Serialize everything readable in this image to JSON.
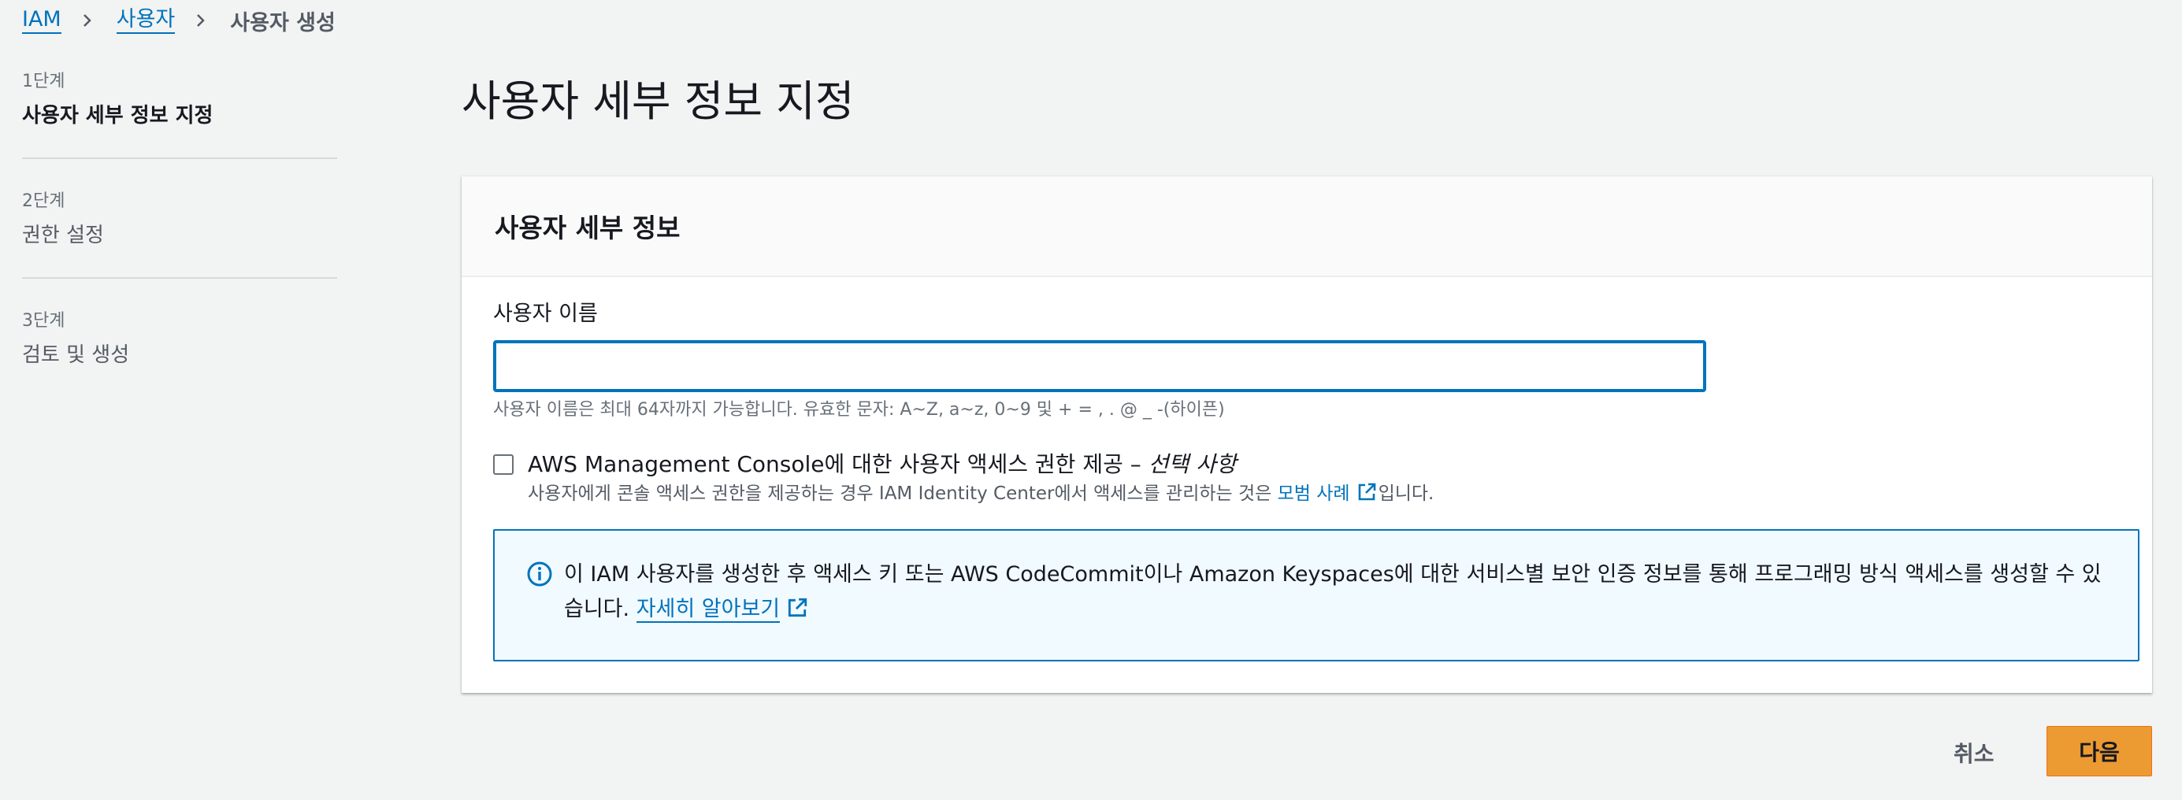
{
  "breadcrumb": {
    "items": [
      "IAM",
      "사용자"
    ],
    "current": "사용자 생성"
  },
  "steps": [
    {
      "number": "1단계",
      "label": "사용자 세부 정보 지정",
      "active": true
    },
    {
      "number": "2단계",
      "label": "권한 설정",
      "active": false
    },
    {
      "number": "3단계",
      "label": "검토 및 생성",
      "active": false
    }
  ],
  "page": {
    "title": "사용자 세부 정보 지정"
  },
  "panel": {
    "header": "사용자 세부 정보",
    "username_label": "사용자 이름",
    "username_value": "",
    "username_constraint": "사용자 이름은 최대 64자까지 가능합니다. 유효한 문자: A~Z, a~z, 0~9 및 + = , . @ _ -(하이픈)",
    "console_access": {
      "checked": false,
      "title": "AWS Management Console에 대한 사용자 액세스 권한 제공",
      "title_dash": " – ",
      "optional": "선택 사항",
      "desc_prefix": "사용자에게 콘솔 액세스 권한을 제공하는 경우 IAM Identity Center에서 액세스를 관리하는 것은 ",
      "desc_link": "모범 사례",
      "desc_suffix": "입니다."
    },
    "info": {
      "text": "이 IAM 사용자를 생성한 후 액세스 키 또는 AWS CodeCommit이나 Amazon Keyspaces에 대한 서비스별 보안 인증 정보를 통해 프로그래밍 방식 액세스를 생성할 수 있습니다. ",
      "link": "자세히 알아보기"
    }
  },
  "footer": {
    "cancel_label": "취소",
    "next_label": "다음"
  },
  "colors": {
    "link": "#0073bb",
    "primary_button": "#ec9a32",
    "background": "#f2f3f3"
  }
}
